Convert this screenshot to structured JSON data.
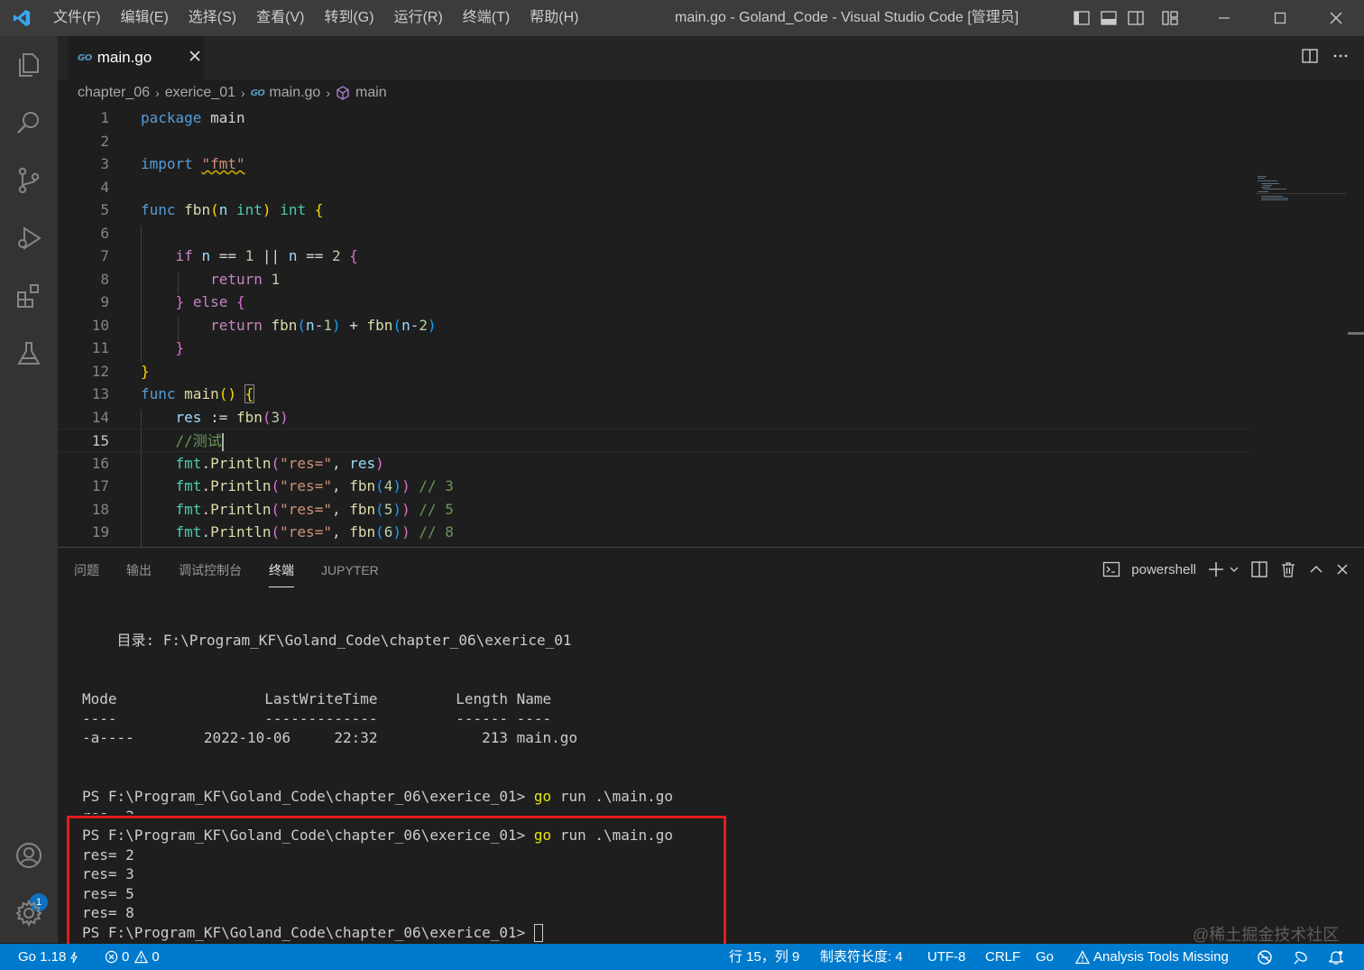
{
  "titlebar": {
    "menus": [
      "文件(F)",
      "编辑(E)",
      "选择(S)",
      "查看(V)",
      "转到(G)",
      "运行(R)",
      "终端(T)",
      "帮助(H)"
    ],
    "title": "main.go - Goland_Code - Visual Studio Code [管理员]"
  },
  "editor": {
    "tab": {
      "label": "main.go",
      "icon": "GO"
    },
    "breadcrumb": [
      "chapter_06",
      "exerice_01",
      "main.go",
      "main"
    ],
    "lines": [
      {
        "n": "1",
        "code": "package main"
      },
      {
        "n": "2",
        "code": ""
      },
      {
        "n": "3",
        "code": "import \"fmt\""
      },
      {
        "n": "4",
        "code": ""
      },
      {
        "n": "5",
        "code": "func fbn(n int) int {"
      },
      {
        "n": "6",
        "code": ""
      },
      {
        "n": "7",
        "code": "    if n == 1 || n == 2 {"
      },
      {
        "n": "8",
        "code": "        return 1"
      },
      {
        "n": "9",
        "code": "    } else {"
      },
      {
        "n": "10",
        "code": "        return fbn(n-1) + fbn(n-2)"
      },
      {
        "n": "11",
        "code": "    }"
      },
      {
        "n": "12",
        "code": "}"
      },
      {
        "n": "13",
        "code": "func main() {"
      },
      {
        "n": "14",
        "code": "    res := fbn(3)"
      },
      {
        "n": "15",
        "code": "    //测试"
      },
      {
        "n": "16",
        "code": "    fmt.Println(\"res=\", res)"
      },
      {
        "n": "17",
        "code": "    fmt.Println(\"res=\", fbn(4)) // 3"
      },
      {
        "n": "18",
        "code": "    fmt.Println(\"res=\", fbn(5)) // 5"
      },
      {
        "n": "19",
        "code": "    fmt.Println(\"res=\", fbn(6)) // 8"
      }
    ],
    "current_line": "15"
  },
  "panel": {
    "tabs": [
      "问题",
      "输出",
      "调试控制台",
      "终端",
      "JUPYTER"
    ],
    "active_tab": "终端",
    "shell": "powershell",
    "terminal": {
      "dir_line": "    目录: F:\\Program_KF\\Goland_Code\\chapter_06\\exerice_01",
      "header": "Mode                 LastWriteTime         Length Name",
      "divider": "----                 -------------         ------ ----",
      "file_row": "-a----        2022-10-06     22:32            213 main.go",
      "prompt": "PS F:\\Program_KF\\Goland_Code\\chapter_06\\exerice_01>",
      "cmd_go": "go",
      "cmd_rest": " run .\\main.go",
      "partial_output": "res= 2",
      "outputs": [
        "res= 2",
        "res= 3",
        "res= 5",
        "res= 8"
      ]
    }
  },
  "watermark": "@稀土掘金技术社区",
  "statusbar": {
    "go_version": "Go 1.18",
    "errors": "0",
    "warnings": "0",
    "position": "行 15，列 9",
    "tab_size": "制表符长度: 4",
    "encoding": "UTF-8",
    "eol": "CRLF",
    "language": "Go",
    "analysis": "Analysis Tools Missing"
  },
  "colors": {
    "accent": "#007acc",
    "titlebar": "#3c3c3c",
    "activitybar": "#333333",
    "editor_bg": "#1e1e1e",
    "highlight_box": "#e81a1a"
  }
}
